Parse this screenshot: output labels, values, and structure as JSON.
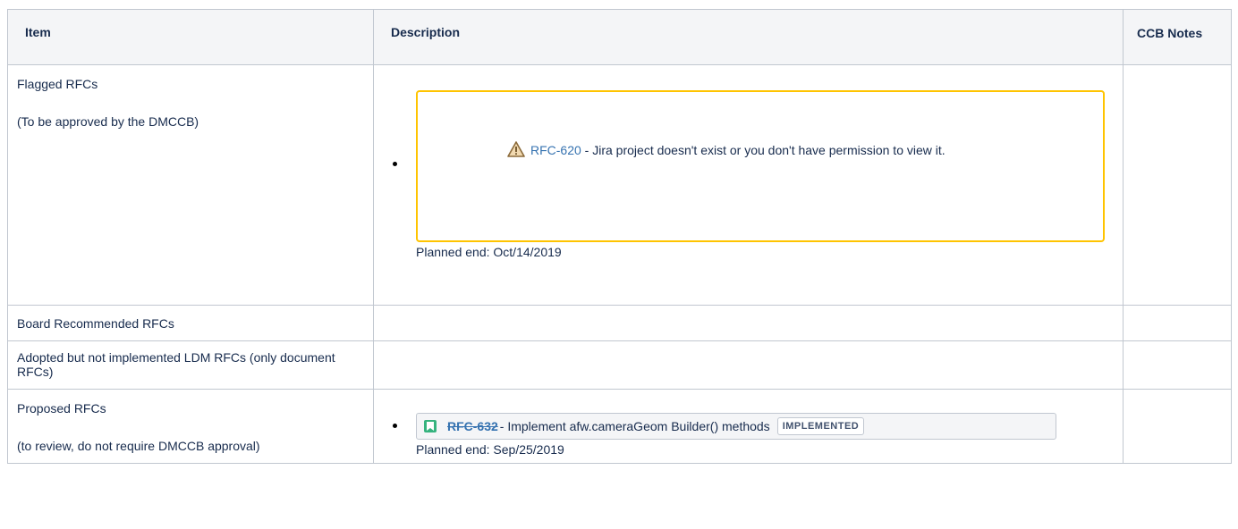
{
  "table": {
    "headers": {
      "item": "Item",
      "description": "Description",
      "ccb_notes": "CCB Notes"
    },
    "rows": [
      {
        "item": "Flagged RFCs",
        "item_note": "(To be approved by the DMCCB)",
        "issue": {
          "key": "RFC-620",
          "message": " - Jira project doesn't exist or you don't have permission to view it.",
          "planned_end": "Planned end: Oct/14/2019"
        }
      },
      {
        "item": "Board Recommended RFCs"
      },
      {
        "item": "Adopted but not implemented LDM RFCs (only document RFCs)"
      },
      {
        "item": "Proposed RFCs",
        "item_note": "(to review, do not require DMCCB approval)",
        "issue": {
          "key": "RFC-632",
          "summary": " - Implement afw.cameraGeom Builder() methods",
          "status": "IMPLEMENTED",
          "planned_end": "Planned end: Sep/25/2019"
        }
      }
    ]
  },
  "colors": {
    "border": "#c1c7d0",
    "header_bg": "#f4f5f7",
    "link": "#3572b0",
    "warning_border": "#ffc400",
    "story_icon": "#36b37e"
  },
  "icons": {
    "warning": "warning-icon",
    "issue_type": "story-icon"
  }
}
